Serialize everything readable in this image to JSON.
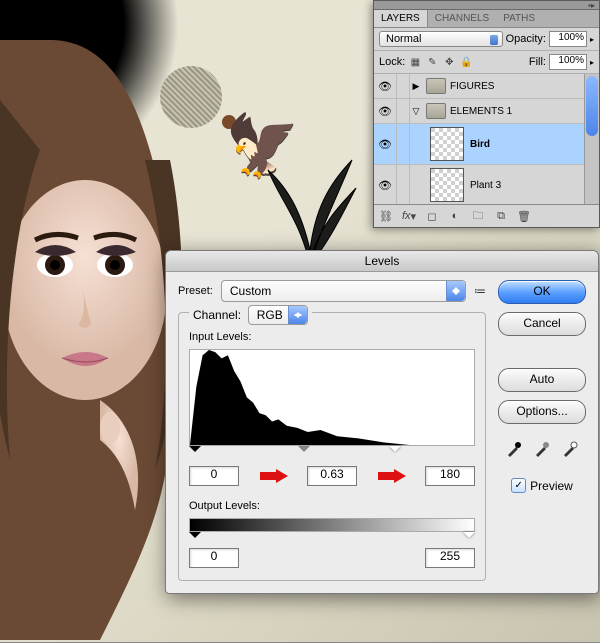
{
  "layers_panel": {
    "tabs": [
      "LAYERS",
      "CHANNELS",
      "PATHS"
    ],
    "active_tab": 0,
    "blend_mode": "Normal",
    "opacity_label": "Opacity:",
    "opacity_value": "100%",
    "lock_label": "Lock:",
    "fill_label": "Fill:",
    "fill_value": "100%",
    "rows": [
      {
        "type": "group",
        "name": "FIGURES",
        "expanded": false,
        "visible": true
      },
      {
        "type": "group",
        "name": "ELEMENTS 1",
        "expanded": true,
        "visible": true
      },
      {
        "type": "layer",
        "name": "Bird",
        "selected": true,
        "visible": true
      },
      {
        "type": "layer",
        "name": "Plant 3",
        "selected": false,
        "visible": true
      }
    ],
    "bottom_icons": [
      "link",
      "fx",
      "mask",
      "adjust",
      "group",
      "new",
      "trash"
    ]
  },
  "levels_dialog": {
    "title": "Levels",
    "preset_label": "Preset:",
    "preset_value": "Custom",
    "channel_label": "Channel:",
    "channel_value": "RGB",
    "input_label": "Input Levels:",
    "input_black": "0",
    "input_gamma": "0.63",
    "input_white": "180",
    "output_label": "Output Levels:",
    "output_black": "0",
    "output_white": "255",
    "buttons": {
      "ok": "OK",
      "cancel": "Cancel",
      "auto": "Auto",
      "options": "Options..."
    },
    "preview_label": "Preview",
    "preview_checked": true
  }
}
